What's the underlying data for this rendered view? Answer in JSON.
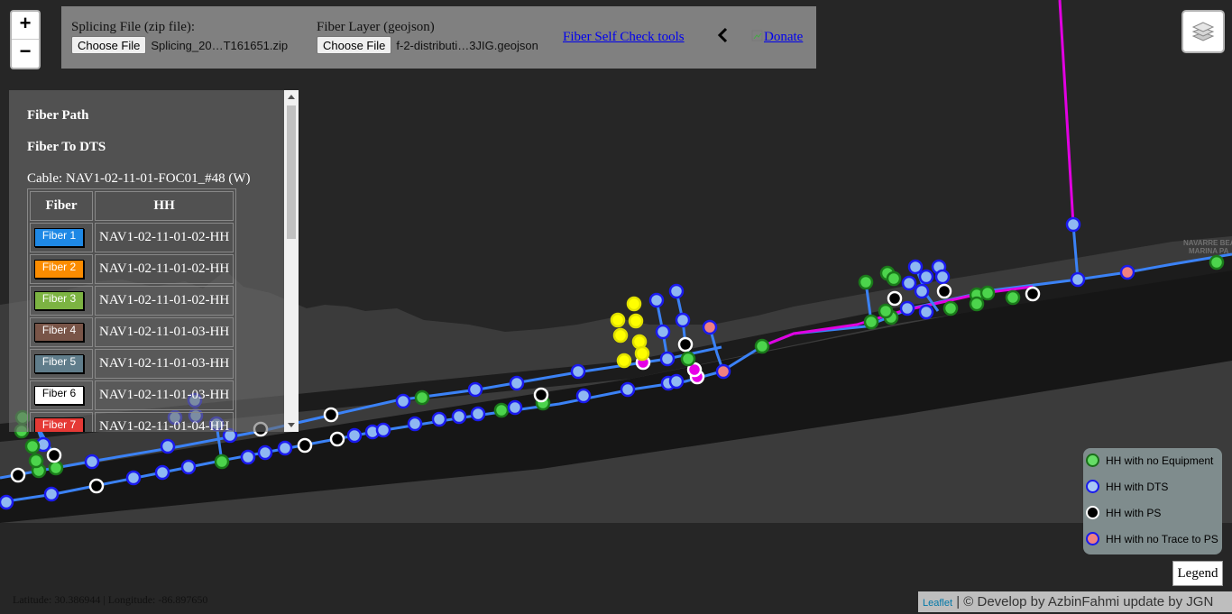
{
  "map": {
    "place_label_1": "NAVARRE BEA",
    "place_label_2": "MARINA PA",
    "colors": {
      "land": "#262626",
      "water_strip": "#141414",
      "hills": "#3b3b3b",
      "route_blue": "#3b82f6",
      "route_magenta": "#e100e1",
      "node_green": "#4cd44c",
      "node_lightblue": "#8fb8f2",
      "node_salmon": "#f08080",
      "node_yellow": "#ffff00",
      "node_magenta": "#e600e6"
    }
  },
  "zoom": {
    "in": "+",
    "out": "−"
  },
  "topbar": {
    "splicing_label": "Splicing File (zip file):",
    "splicing_button": "Choose File",
    "splicing_filename": "Splicing_20…T161651.zip",
    "fiber_label": "Fiber Layer (geojson)",
    "fiber_button": "Choose File",
    "fiber_filename": "f-2-distributi…3JIG.geojson",
    "selfcheck_link": "Fiber Self Check tools",
    "donate_link": "Donate"
  },
  "panel": {
    "heading1": "Fiber Path",
    "heading2": "Fiber To DTS",
    "cable": "Cable: NAV1-02-11-01-FOC01_#48 (W)",
    "col_fiber": "Fiber",
    "col_hh": "HH",
    "rows": [
      {
        "fiber": "Fiber 1",
        "color": "#1e88e5",
        "hh": "NAV1-02-11-01-02-HH"
      },
      {
        "fiber": "Fiber 2",
        "color": "#fb8c00",
        "hh": "NAV1-02-11-01-02-HH"
      },
      {
        "fiber": "Fiber 3",
        "color": "#7cb342",
        "hh": "NAV1-02-11-01-02-HH"
      },
      {
        "fiber": "Fiber 4",
        "color": "#795548",
        "hh": "NAV1-02-11-01-03-HH"
      },
      {
        "fiber": "Fiber 5",
        "color": "#607d8b",
        "hh": "NAV1-02-11-01-03-HH"
      },
      {
        "fiber": "Fiber 6",
        "color": "#ffffff",
        "hh": "NAV1-02-11-01-03-HH"
      },
      {
        "fiber": "Fiber 7",
        "color": "#e53935",
        "hh": "NAV1-02-11-01-04-HH"
      }
    ]
  },
  "legend": {
    "items": [
      {
        "label": "HH with no Equipment",
        "fill": "#66dd66",
        "stroke": "#1a6e1a"
      },
      {
        "label": "HH with DTS",
        "fill": "#a9c8f5",
        "stroke": "#1a1aee"
      },
      {
        "label": "HH with PS",
        "fill": "#000000",
        "stroke": "#ffffff"
      },
      {
        "label": "HH with no Trace to PS",
        "fill": "#f08080",
        "stroke": "#1a1aee"
      }
    ],
    "button": "Legend"
  },
  "status": {
    "coords": "Latitude: 30.386944 | Longitude: -86.897650"
  },
  "attribution": {
    "leaflet": "Leaflet",
    "credit": "© Develop by AzbinFahmi update by JGN"
  }
}
